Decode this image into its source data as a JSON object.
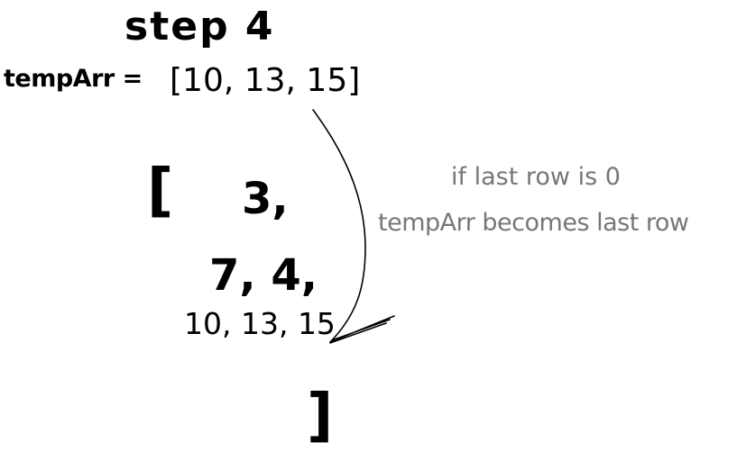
{
  "diagram": {
    "title": "step 4",
    "temp_array": {
      "label": "tempArr =",
      "value": "[10, 13, 15]"
    },
    "matrix": {
      "open_bracket": "[",
      "rows": [
        "3,",
        "7, 4,",
        "10, 13, 15"
      ],
      "close_bracket": "]"
    },
    "note": {
      "line1": "if last row is 0",
      "line2": "tempArr becomes last row"
    },
    "colors": {
      "ink": "#000000",
      "note": "#777777",
      "background": "#ffffff"
    }
  }
}
